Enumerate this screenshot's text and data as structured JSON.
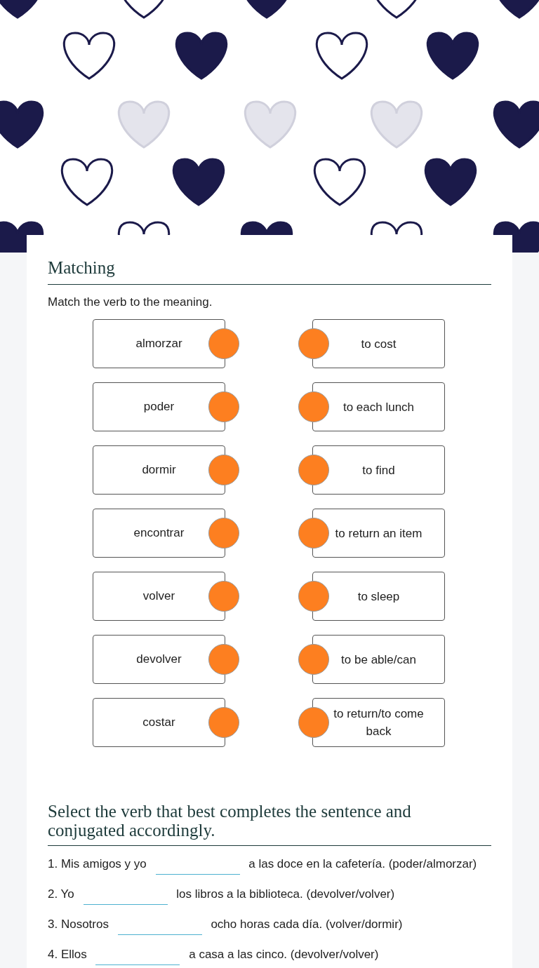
{
  "matching": {
    "title": "Matching",
    "instruction": "Match the verb to the meaning.",
    "left": [
      "almorzar",
      "poder",
      "dormir",
      "encontrar",
      "volver",
      "devolver",
      "costar"
    ],
    "right": [
      "to cost",
      "to each lunch",
      "to find",
      "to return an item",
      "to sleep",
      "to be able/can",
      "to return/to come back"
    ]
  },
  "fill_in": {
    "title": "Select the verb that best completes the sentence and conjugated accordingly.",
    "items": [
      {
        "before": "1. Mis amigos y yo",
        "after": "a las doce en la cafetería. (poder/almorzar)"
      },
      {
        "before": "2. Yo",
        "after": "los libros a la biblioteca. (devolver/volver)"
      },
      {
        "before": "3. Nosotros",
        "after": "ocho horas cada día. (volver/dormir)"
      },
      {
        "before": "4. Ellos",
        "after": "a casa a las cinco. (devolver/volver)"
      }
    ]
  }
}
